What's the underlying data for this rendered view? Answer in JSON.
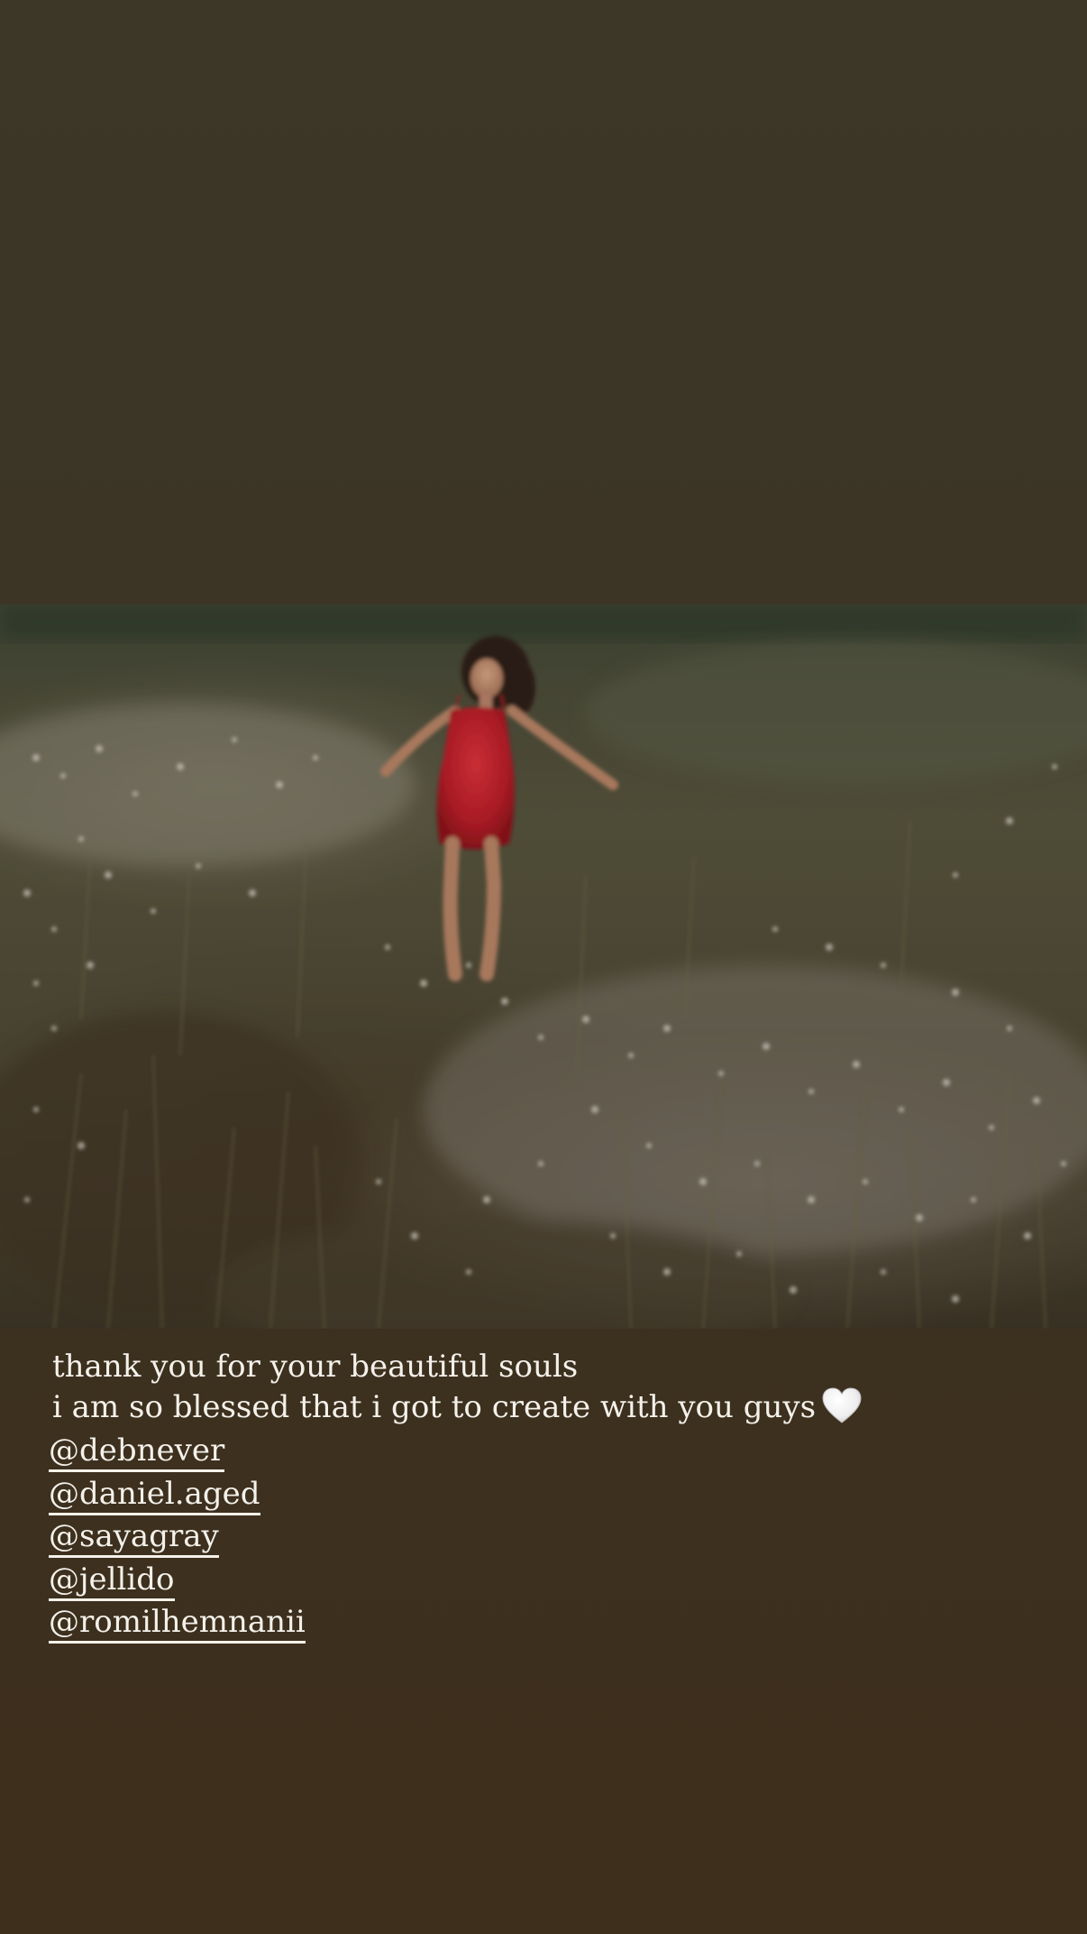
{
  "story": {
    "background_color_top": "#3c3727",
    "background_color_bottom": "#3e2f1c"
  },
  "photo": {
    "description_icon": "photo-field-woman-red-dress",
    "dress_color": "#c4202a"
  },
  "caption": {
    "line1": "thank you for your beautiful souls",
    "line2": "i am so blessed that i got to create with you guys",
    "emoji": "white-heart-icon"
  },
  "mentions": [
    {
      "handle": "@debnever"
    },
    {
      "handle": "@daniel.aged"
    },
    {
      "handle": "@sayagray"
    },
    {
      "handle": "@jellido"
    },
    {
      "handle": "@romilhemnanii"
    }
  ]
}
